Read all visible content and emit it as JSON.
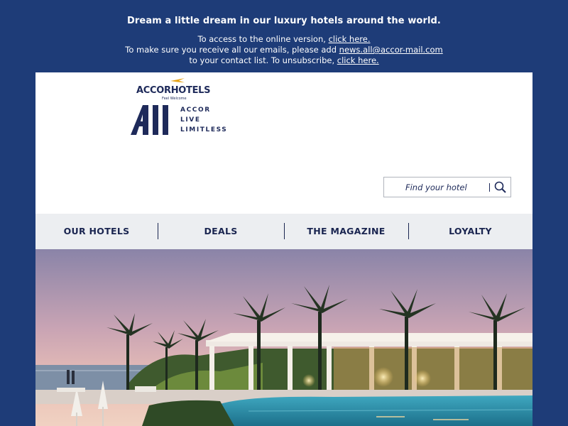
{
  "preheader": {
    "tagline": "Dream a little dream in our luxury hotels around the world.",
    "line1_text": "To access to the online version, ",
    "line1_link": "click here.",
    "line2_text": "To make sure you receive all our emails, please add ",
    "line2_link": "news.all@accor-mail.com",
    "line3_text": "to your contact list. To unsubscribe, ",
    "line3_link": "click here."
  },
  "logo": {
    "brand": "ACCORHOTELS",
    "slogan": "Feel Welcome",
    "all_mark": "All",
    "all_tag1": "ACCOR",
    "all_tag2": "LIVE",
    "all_tag3": "LIMITLESS"
  },
  "search": {
    "placeholder": "Find your hotel",
    "icon": "search-icon"
  },
  "nav": {
    "items": [
      {
        "label": "OUR HOTELS"
      },
      {
        "label": "DEALS"
      },
      {
        "label": "THE MAGAZINE"
      },
      {
        "label": "LOYALTY"
      }
    ]
  },
  "colors": {
    "background": "#1e3c78",
    "navy": "#1e2a5a",
    "nav_bg": "#eceef1",
    "accent_gold": "#e6a419"
  }
}
